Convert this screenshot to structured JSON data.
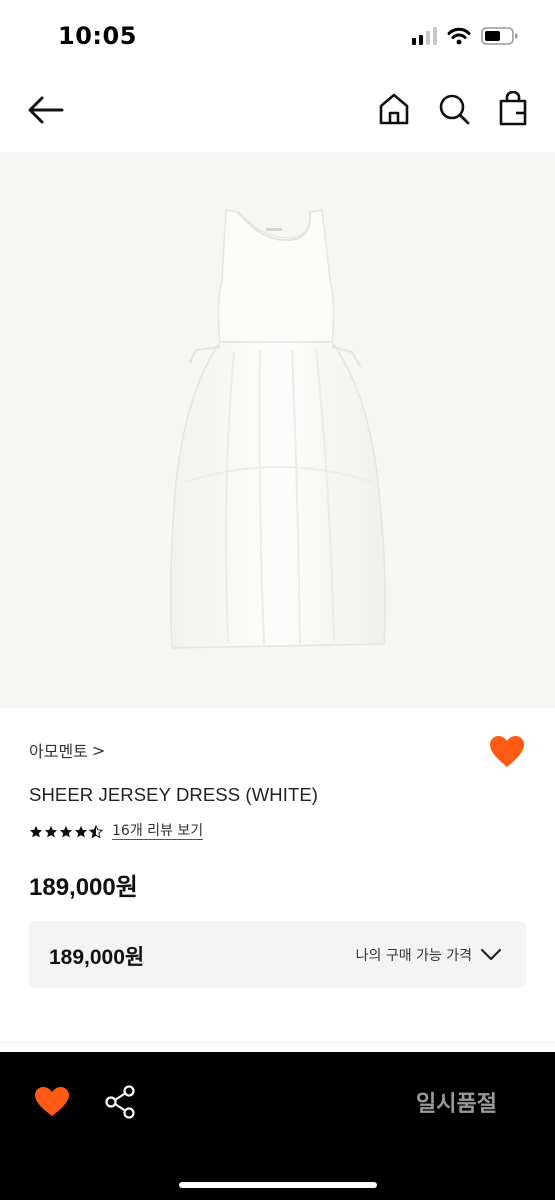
{
  "status_bar": {
    "time": "10:05"
  },
  "nav": {
    "icons": [
      "back-arrow-icon",
      "home-icon",
      "search-icon",
      "shopping-bag-icon"
    ]
  },
  "product": {
    "brand": "아모멘토",
    "brand_chevron": ">",
    "title": "SHEER JERSEY DRESS (WHITE)",
    "rating": 4.5,
    "rating_max": 5,
    "review_link": "16개 리뷰 보기",
    "price": "189,000원"
  },
  "price_box": {
    "value": "189,000원",
    "label": "나의 구매 가능 가격"
  },
  "bottom_bar": {
    "soldout_label": "일시품절"
  },
  "colors": {
    "accent": "#ff5a14",
    "bottom_bar_bg": "#000000",
    "soldout_text": "#9a9a9a"
  }
}
